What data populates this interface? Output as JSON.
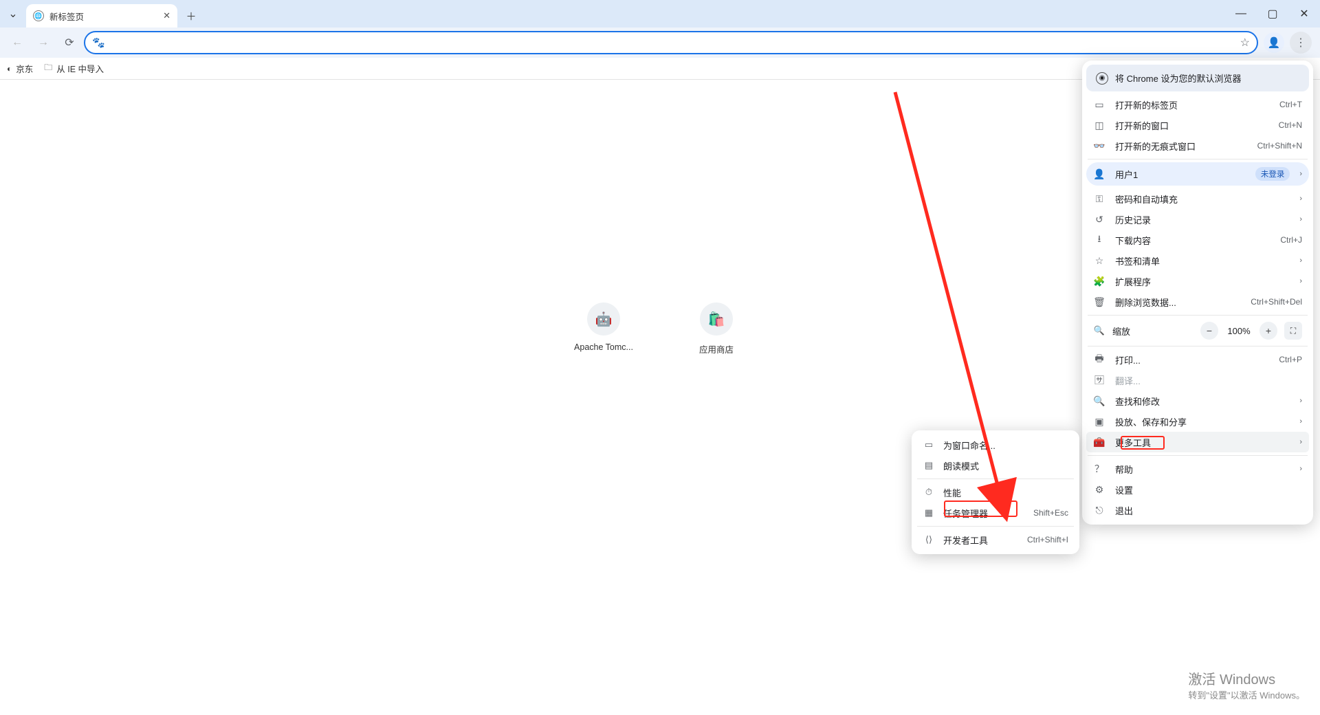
{
  "tab": {
    "title": "新标签页"
  },
  "bookmarks": {
    "jd": "京东",
    "ie": "从 IE 中导入"
  },
  "shortcuts": {
    "tomcat": "Apache Tomc...",
    "store": "应用商店"
  },
  "menu": {
    "default_browser": "将 Chrome 设为您的默认浏览器",
    "new_tab": {
      "label": "打开新的标签页",
      "kbd": "Ctrl+T"
    },
    "new_window": {
      "label": "打开新的窗口",
      "kbd": "Ctrl+N"
    },
    "incognito": {
      "label": "打开新的无痕式窗口",
      "kbd": "Ctrl+Shift+N"
    },
    "user": {
      "label": "用户1",
      "status": "未登录"
    },
    "passwords": "密码和自动填充",
    "history": "历史记录",
    "downloads": {
      "label": "下载内容",
      "kbd": "Ctrl+J"
    },
    "bookmarks": "书签和清单",
    "extensions": "扩展程序",
    "clear_data": {
      "label": "删除浏览数据...",
      "kbd": "Ctrl+Shift+Del"
    },
    "zoom": {
      "label": "缩放",
      "value": "100%"
    },
    "print": {
      "label": "打印...",
      "kbd": "Ctrl+P"
    },
    "translate": "翻译...",
    "find_edit": "查找和修改",
    "cast_save_share": "投放、保存和分享",
    "more_tools": "更多工具",
    "help": "帮助",
    "settings": "设置",
    "exit": "退出"
  },
  "submenu": {
    "name_window": "为窗口命名...",
    "reading_mode": "朗读模式",
    "performance": "性能",
    "task_manager": {
      "label": "任务管理器",
      "kbd": "Shift+Esc"
    },
    "devtools": {
      "label": "开发者工具",
      "kbd": "Ctrl+Shift+I"
    }
  },
  "watermark": {
    "l1": "激活 Windows",
    "l2": "转到\"设置\"以激活 Windows。"
  }
}
